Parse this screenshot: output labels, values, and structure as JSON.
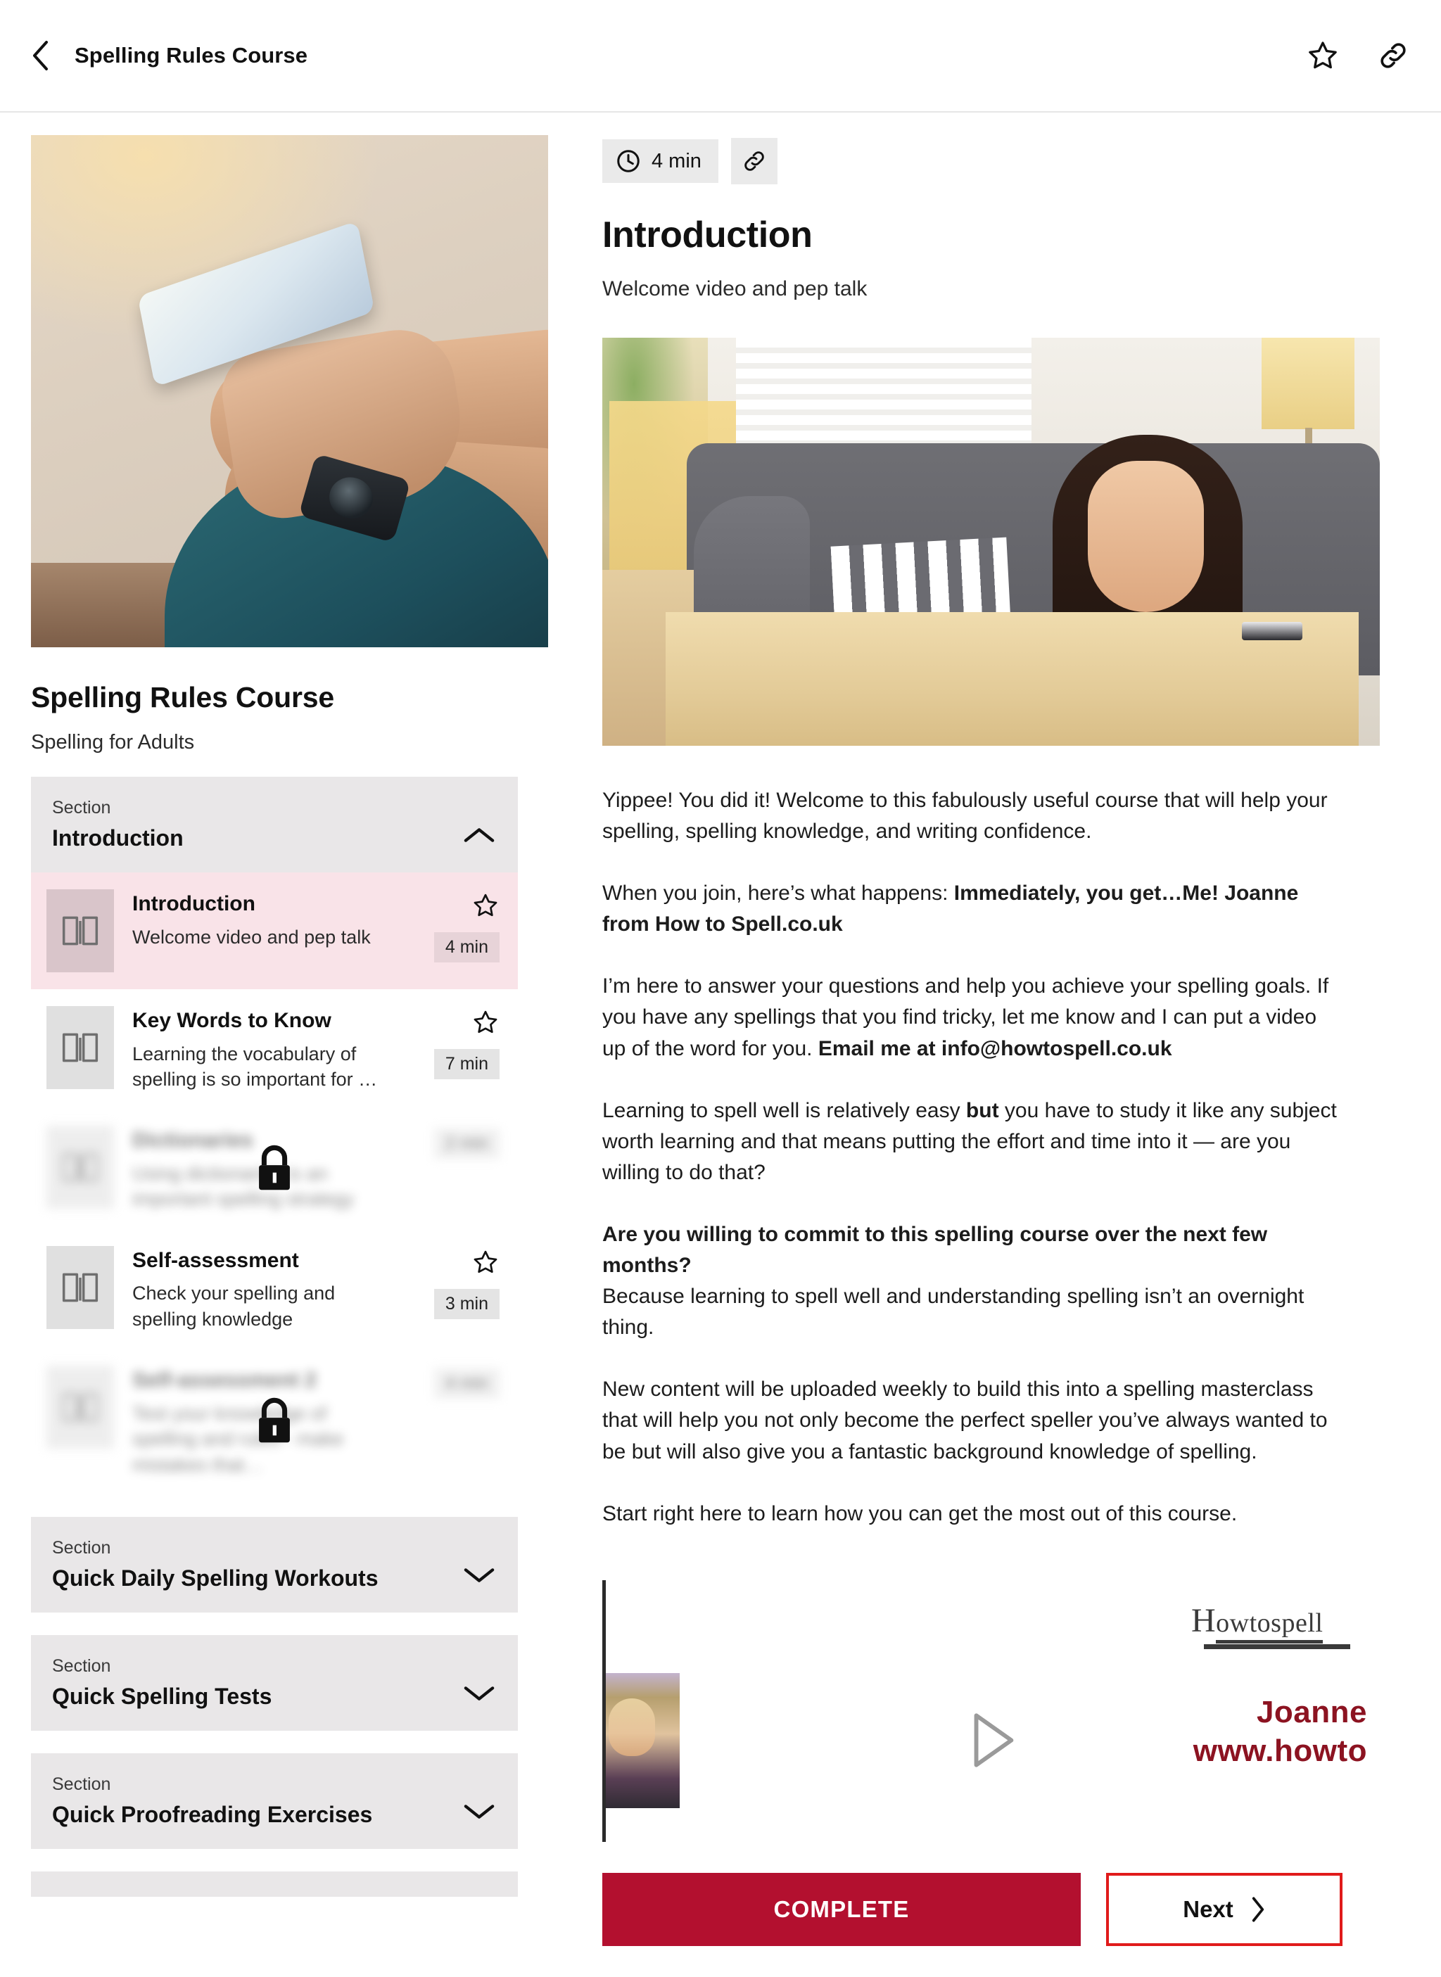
{
  "topbar": {
    "title": "Spelling Rules Course",
    "back_icon": "chevron-left-icon",
    "favorite_icon": "star-outline-icon",
    "share_icon": "link-icon"
  },
  "sidebar": {
    "course_title": "Spelling Rules Course",
    "course_subtitle": "Spelling for Adults",
    "sections": [
      {
        "label": "Section",
        "name": "Introduction",
        "expanded": true,
        "chevron": "chevron-up-icon",
        "lessons": [
          {
            "title": "Introduction",
            "desc": "Welcome video and pep talk",
            "duration": "4 min",
            "active": true,
            "locked": false,
            "icon": "book-icon",
            "star": "star-outline-icon"
          },
          {
            "title": "Key Words to Know",
            "desc": "Learning the vocabulary of spelling is so important for …",
            "duration": "7 min",
            "active": false,
            "locked": false,
            "icon": "book-icon",
            "star": "star-outline-icon"
          },
          {
            "title": "Dictionaries",
            "desc": "Using dictionaries is an important spelling strategy",
            "duration": "2 min",
            "active": false,
            "locked": true,
            "icon": "book-icon",
            "lock_icon": "lock-icon"
          },
          {
            "title": "Self-assessment",
            "desc": "Check your spelling and spelling knowledge",
            "duration": "3 min",
            "active": false,
            "locked": false,
            "icon": "book-icon",
            "star": "star-outline-icon"
          },
          {
            "title": "Self-assessment 2",
            "desc": "Test your knowledge of spelling and rules - make mistakes that…",
            "duration": "4 min",
            "active": false,
            "locked": true,
            "icon": "book-icon",
            "lock_icon": "lock-icon"
          }
        ]
      },
      {
        "label": "Section",
        "name": "Quick Daily Spelling Workouts",
        "expanded": false,
        "chevron": "chevron-down-icon",
        "lessons": []
      },
      {
        "label": "Section",
        "name": "Quick Spelling Tests",
        "expanded": false,
        "chevron": "chevron-down-icon",
        "lessons": []
      },
      {
        "label": "Section",
        "name": "Quick Proofreading Exercises",
        "expanded": false,
        "chevron": "chevron-down-icon",
        "lessons": []
      }
    ]
  },
  "content": {
    "duration": "4 min",
    "clock_icon": "clock-icon",
    "link_icon": "link-icon",
    "heading": "Introduction",
    "subheading": "Welcome video and pep talk",
    "paragraphs": [
      {
        "runs": [
          {
            "text": "Yippee! You did it! Welcome to this fabulously useful course that will help your spelling, spelling knowledge, and writing confidence.",
            "bold": false
          }
        ]
      },
      {
        "runs": [
          {
            "text": "When you join, here’s what happens: ",
            "bold": false
          },
          {
            "text": "Immediately, you get…Me! Joanne from How to Spell.co.uk",
            "bold": true
          }
        ]
      },
      {
        "runs": [
          {
            "text": "I’m here to answer your questions and help you achieve your spelling goals. If you have any spellings that you find tricky, let me know and I can put a video up of the word for you. ",
            "bold": false
          },
          {
            "text": "Email me at info@howtospell.co.uk",
            "bold": true
          }
        ]
      },
      {
        "runs": [
          {
            "text": "Learning to spell well is relatively easy ",
            "bold": false
          },
          {
            "text": "but",
            "bold": true
          },
          {
            "text": " you have to study it like any subject worth learning and that means putting the effort and time into it — are you willing to do that?",
            "bold": false
          }
        ]
      },
      {
        "runs": [
          {
            "text": "Are you willing to commit to this spelling course over the next few months?",
            "bold": true
          },
          {
            "text": "\nBecause learning to spell well and understanding spelling isn’t an overnight thing.",
            "bold": false
          }
        ]
      },
      {
        "runs": [
          {
            "text": "New content will be uploaded weekly to build this into a spelling masterclass that will help you not only become the perfect speller you’ve always wanted to be but will also give you a fantastic background knowledge of spelling.",
            "bold": false
          }
        ]
      },
      {
        "runs": [
          {
            "text": "Start right here to learn how you can get the most out of this course.",
            "bold": false
          }
        ]
      }
    ],
    "video": {
      "logo_first_letter": "H",
      "logo_rest": "owtospell",
      "presenter_name": "Joanne",
      "presenter_url": "www.howto",
      "play_icon": "play-triangle-icon"
    },
    "complete_label": "COMPLETE",
    "next_label": "Next",
    "next_icon": "chevron-right-icon"
  },
  "colors": {
    "accent_crimson": "#b3102f",
    "next_border_red": "#e01b1b",
    "active_row_pink": "#f9e3e8",
    "section_gray": "#e9e7e8",
    "brand_dark_red": "#8c1321"
  }
}
